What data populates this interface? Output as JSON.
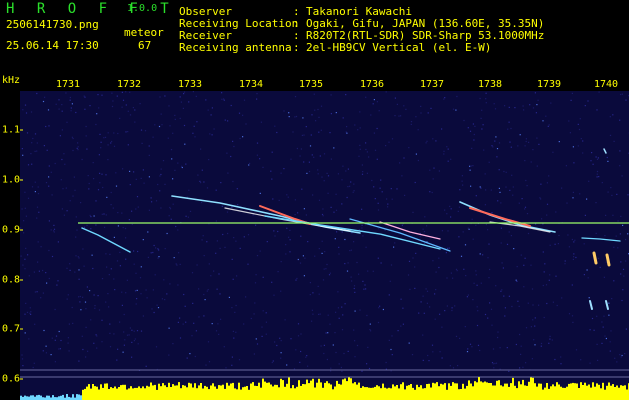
{
  "header": {
    "app_logo": "H R O F F T",
    "version": "1.0.0",
    "filename": "2506141730.png",
    "datetime": "25.06.14 17:30",
    "meteor_label": "meteor",
    "meteor_count": "67",
    "fields": [
      {
        "label": "Observer",
        "value": "Takanori Kawachi"
      },
      {
        "label": "Receiving Location",
        "value": "Ogaki, Gifu, JAPAN (136.60E, 35.35N)"
      },
      {
        "label": "Receiver",
        "value": "R820T2(RTL-SDR) SDR-Sharp 53.1000MHz"
      },
      {
        "label": "Receiving antenna",
        "value": "2el-HB9CV Vertical (el. E-W)"
      }
    ]
  },
  "spectrogram": {
    "y_unit": "kHz",
    "x_ticks": [
      "1731",
      "1732",
      "1733",
      "1734",
      "1735",
      "1736",
      "1737",
      "1738",
      "1739",
      "1740"
    ],
    "y_ticks": [
      "1.1",
      "1.0",
      "0.9",
      "0.8",
      "0.7",
      "0.6"
    ],
    "colors": {
      "background": "#0a0a3c",
      "carrier": "#9cff6a",
      "axis_text": "#ffff00",
      "level_bars": "#ffff00",
      "logo": "#2be02b"
    }
  }
}
